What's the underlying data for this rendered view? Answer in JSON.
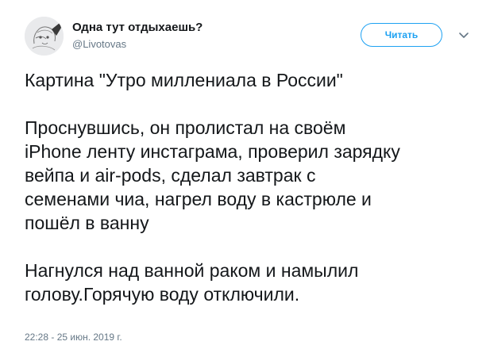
{
  "author": {
    "name": "Одна тут отдыхаешь?",
    "handle": "@Livotovas"
  },
  "actions": {
    "follow_label": "Читать",
    "menu_icon": "chevron-down-icon"
  },
  "tweet": {
    "title_line": "Картина \"Утро миллениала в России\"",
    "paragraph1": [
      "Проснувшись, он пролистал на своём",
      "iPhone ленту инстаграма, проверил зарядку",
      "вейпа и air-pods, сделал завтрак с",
      "семенами чиа, нагрел воду в кастрюле и",
      "пошёл в ванну"
    ],
    "paragraph2": [
      "Нагнулся над ванной раком и намылил",
      "голову.Горячую воду отключили."
    ]
  },
  "meta": {
    "timestamp": "22:28 - 25 июн. 2019 г."
  },
  "colors": {
    "accent": "#1da1f2",
    "secondary_text": "#657786",
    "primary_text": "#14171a"
  }
}
